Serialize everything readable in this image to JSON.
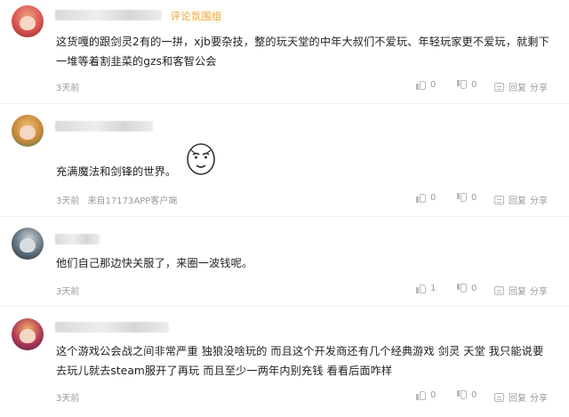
{
  "comments": [
    {
      "badge": "评论氛围组",
      "content": "这货嘎的跟剑灵2有的一拼，xjb要杂技，整的玩天堂的中年大叔们不爱玩、年轻玩家更不爱玩，就剩下一堆等着割韭菜的gzs和客智公会",
      "time": "3天前",
      "source": "",
      "likes": "0",
      "dislikes": "0",
      "reply": "回复",
      "share": "分享",
      "avatar_color": "#d9534f"
    },
    {
      "badge": "",
      "content": "充满魔法和剑锋的世界。",
      "time": "3天前",
      "source": "来自17173APP客户端",
      "likes": "0",
      "dislikes": "0",
      "reply": "回复",
      "share": "分享",
      "avatar_color": "#c8893a"
    },
    {
      "badge": "",
      "content": "他们自己那边快关服了，来圈一波钱呢。",
      "time": "3天前",
      "source": "",
      "likes": "1",
      "dislikes": "0",
      "reply": "回复",
      "share": "分享",
      "avatar_color": "#5d6f7e"
    },
    {
      "badge": "",
      "content": "这个游戏公会战之间非常严重   独狼没啥玩的   而且这个开发商还有几个经典游戏   剑灵  天堂   我只能说要去玩儿就去steam服开了再玩   而且至少一两年内别充钱 看看后面咋样",
      "time": "3天前",
      "source": "",
      "likes": "0",
      "dislikes": "0",
      "reply": "回复",
      "share": "分享",
      "avatar_color": "#b03a55"
    }
  ]
}
